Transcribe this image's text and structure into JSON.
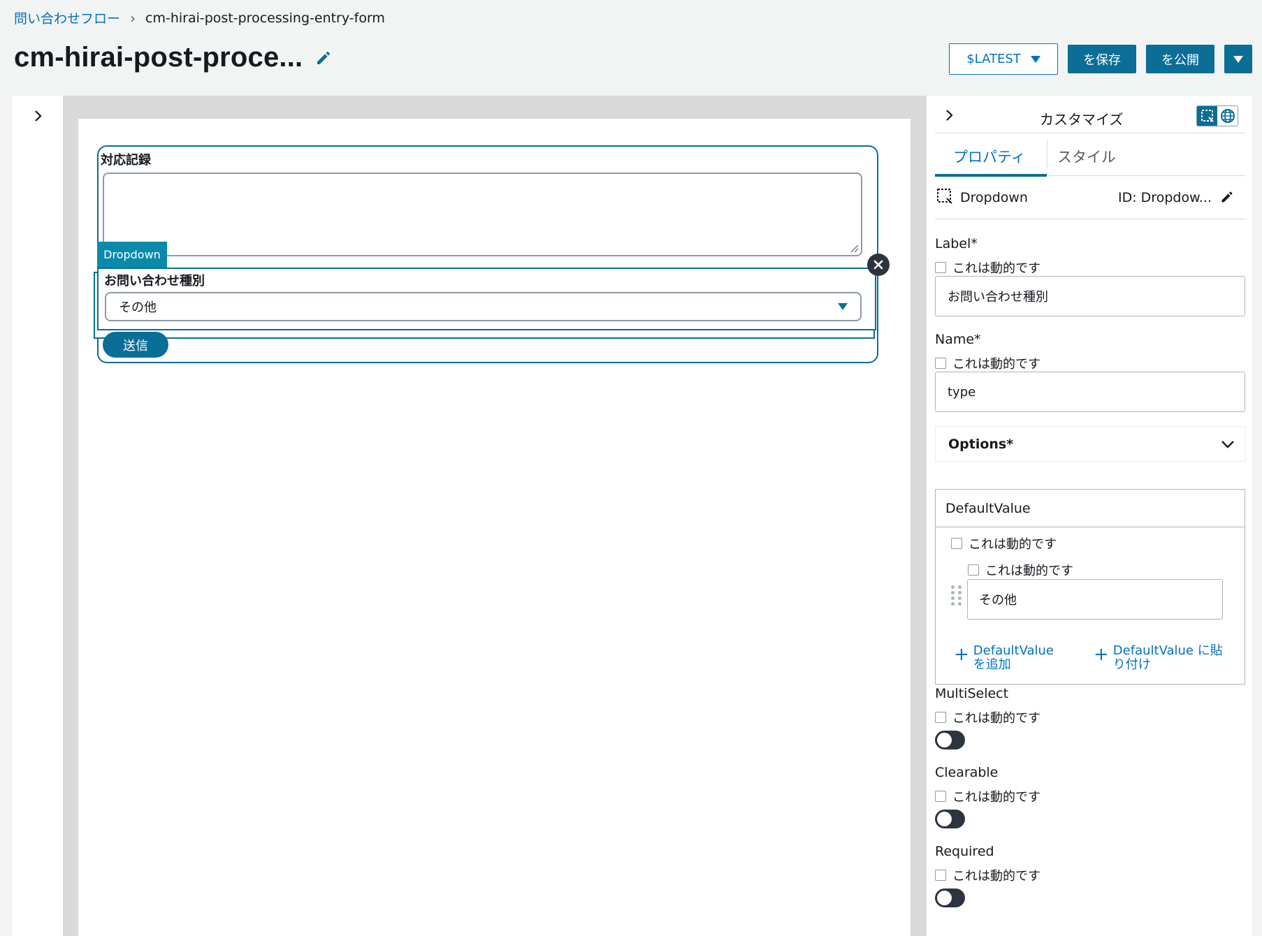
{
  "breadcrumb": {
    "parent": "問い合わせフロー",
    "current": "cm-hirai-post-processing-entry-form"
  },
  "page": {
    "title": "cm-hirai-post-proce..."
  },
  "actions": {
    "version": "$LATEST",
    "save": "を保存",
    "publish": "を公開"
  },
  "form": {
    "record_label": "対応記録",
    "dropdown_tag": "Dropdown",
    "dropdown_label": "お問い合わせ種別",
    "dropdown_value": "その他",
    "submit": "送信"
  },
  "panel": {
    "title": "カスタマイズ",
    "tabs": [
      "プロパティ",
      "スタイル"
    ],
    "component_type": "Dropdown",
    "component_id": "ID: Dropdow...",
    "dynamic_label": "これは動的です",
    "label_title": "Label*",
    "label_value": "お問い合わせ種別",
    "name_title": "Name*",
    "name_value": "type",
    "options_title": "Options*",
    "default_value_title": "DefaultValue",
    "default_value_item": "その他",
    "add_default_1": "DefaultValue",
    "add_default_2": "を追加",
    "paste_default_1": "DefaultValue に貼",
    "paste_default_2": "り付け",
    "multiselect_title": "MultiSelect",
    "clearable_title": "Clearable",
    "required_title": "Required"
  },
  "colors": {
    "primary": "#0a6e96",
    "link": "#0073bb",
    "tag": "#0a8aaa"
  }
}
